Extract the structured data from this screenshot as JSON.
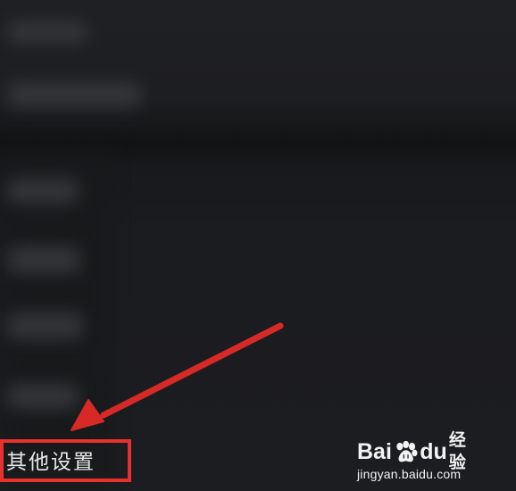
{
  "screen": {
    "title": "",
    "background": "#1b1c1f"
  },
  "settings": {
    "highlighted_item_label": "其他设置"
  },
  "annotations": {
    "highlight_color": "#e8312e",
    "arrow_color": "#d72a26",
    "arrow_icon": "arrow-icon"
  },
  "watermark": {
    "brand_bai": "Bai",
    "brand_du": "du",
    "brand_cn": "经验",
    "url": "jingyan.baidu.com"
  }
}
